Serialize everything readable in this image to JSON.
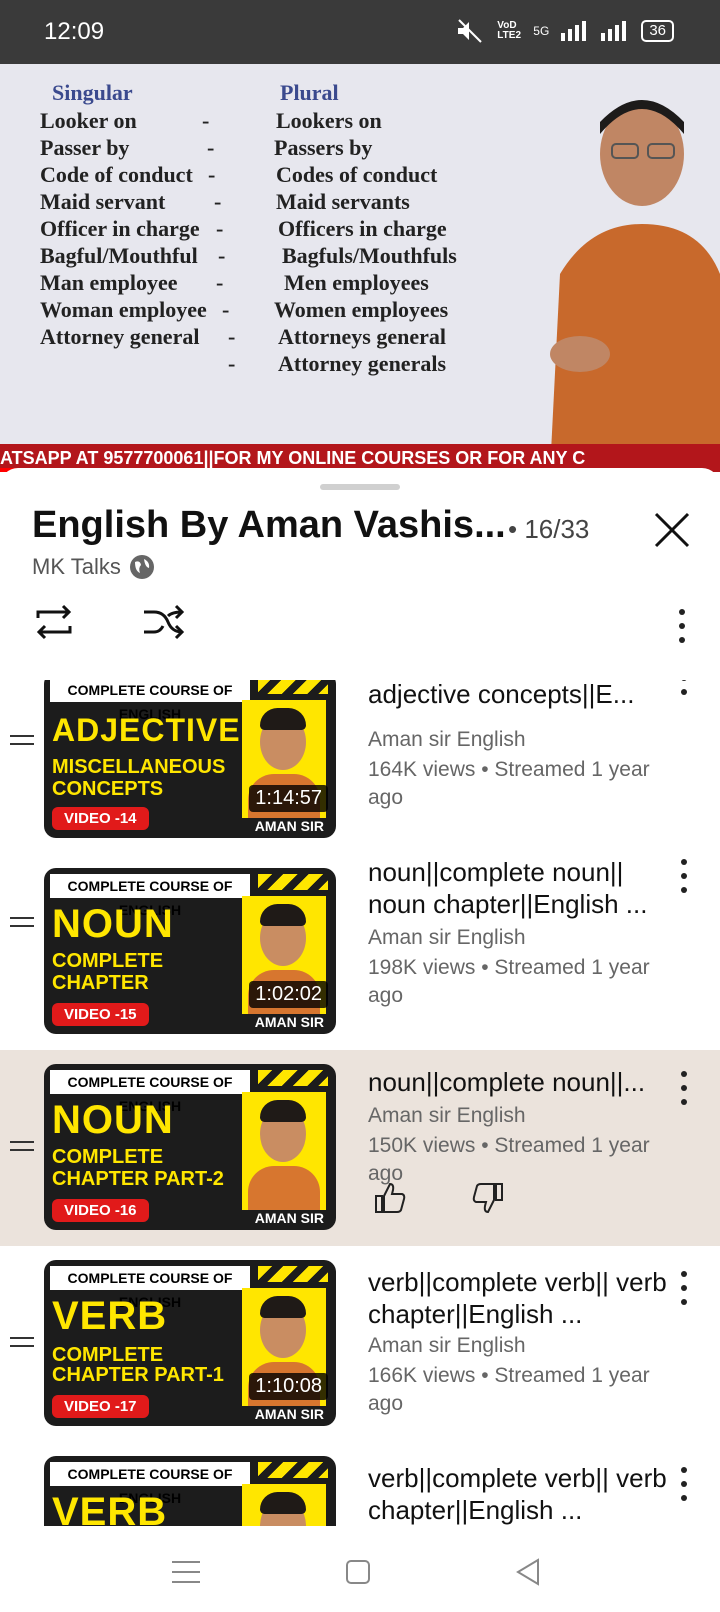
{
  "status_bar": {
    "time": "12:09",
    "network": "5G",
    "volte": "VoD LTE2",
    "battery": "36"
  },
  "video": {
    "slide": {
      "singular_header": "Singular",
      "plural_header": "Plural",
      "rows": [
        {
          "singular": "Looker on",
          "dash": "-",
          "plural": "Lookers on"
        },
        {
          "singular": "Passer by",
          "dash": "-",
          "plural": "Passers by"
        },
        {
          "singular": "Code of conduct",
          "dash": "-",
          "plural": "Codes of conduct"
        },
        {
          "singular": "Maid servant",
          "dash": "-",
          "plural": "Maid servants"
        },
        {
          "singular": "Officer in charge",
          "dash": "-",
          "plural": "Officers in charge"
        },
        {
          "singular": "Bagful/Mouthful",
          "dash": "-",
          "plural": "Bagfuls/Mouthfuls"
        },
        {
          "singular": "Man employee",
          "dash": "-",
          "plural": "Men employees"
        },
        {
          "singular": "Woman employee",
          "dash": "-",
          "plural": "Women employees"
        },
        {
          "singular": "Attorney general",
          "dash": "-",
          "plural": "Attorneys general"
        },
        {
          "singular": "",
          "dash": "-",
          "plural": "Attorney generals"
        }
      ]
    },
    "ticker": "ATSAPP AT 9577700061||FOR MY ONLINE COURSES OR FOR ANY C"
  },
  "playlist": {
    "title": "English By Aman Vashis...",
    "position": "• 16/33",
    "channel": "MK Talks",
    "items": [
      {
        "thumb_top": "COMPLETE COURSE OF ENGLISH",
        "thumb_big": "ADJECTIVE",
        "thumb_sub1": "MISCELLANEOUS",
        "thumb_sub2": "CONCEPTS",
        "thumb_video": "VIDEO -14",
        "duration": "1:14:57",
        "brand": "AMAN SIR",
        "title": "Complete adjective|| adjective concepts||E...",
        "channel": "Aman sir English",
        "meta": "164K views • Streamed 1 year ago"
      },
      {
        "thumb_top": "COMPLETE COURSE OF ENGLISH",
        "thumb_big": "NOUN",
        "thumb_sub1": "COMPLETE",
        "thumb_sub2": "CHAPTER",
        "thumb_video": "VIDEO -15",
        "duration": "1:02:02",
        "brand": "AMAN SIR",
        "title": "noun||complete noun|| noun chapter||English ...",
        "channel": "Aman sir English",
        "meta": "198K views • Streamed 1 year ago"
      },
      {
        "thumb_top": "COMPLETE COURSE OF ENGLISH",
        "thumb_big": "NOUN",
        "thumb_sub1": "COMPLETE",
        "thumb_sub2": "CHAPTER PART-2",
        "thumb_video": "VIDEO -16",
        "duration": "",
        "brand": "AMAN SIR",
        "title": "noun||complete noun||...",
        "channel": "Aman sir English",
        "meta": "150K views • Streamed 1 year ago"
      },
      {
        "thumb_top": "COMPLETE COURSE OF ENGLISH",
        "thumb_big": "VERB",
        "thumb_sub1": "COMPLETE",
        "thumb_sub2": "CHAPTER PART-1",
        "thumb_video": "VIDEO -17",
        "duration": "1:10:08",
        "brand": "AMAN SIR",
        "title": "verb||complete verb|| verb chapter||English ...",
        "channel": "Aman sir English",
        "meta": "166K views • Streamed 1 year ago"
      },
      {
        "thumb_top": "COMPLETE COURSE OF ENGLISH",
        "thumb_big": "VERB",
        "thumb_sub1": "",
        "thumb_sub2": "",
        "thumb_video": "",
        "duration": "",
        "brand": "",
        "title": "verb||complete verb|| verb chapter||English ...",
        "channel": "",
        "meta": ""
      }
    ]
  },
  "icons": {
    "mute": "mute-icon",
    "signal": "signal-icon",
    "globe": "globe-icon",
    "loop": "loop-icon",
    "shuffle": "shuffle-icon",
    "more": "more-vert-icon",
    "close": "close-icon",
    "drag": "drag-handle-icon",
    "like": "thumb-up-icon",
    "dislike": "thumb-down-icon",
    "nav_menu": "menu-icon",
    "nav_home": "square-icon",
    "nav_back": "back-icon"
  },
  "colors": {
    "ticker": "#b3161b",
    "active_row": "#ebe3dc",
    "thumb_yellow": "#ffe600",
    "thumb_red": "#e11a1a"
  }
}
